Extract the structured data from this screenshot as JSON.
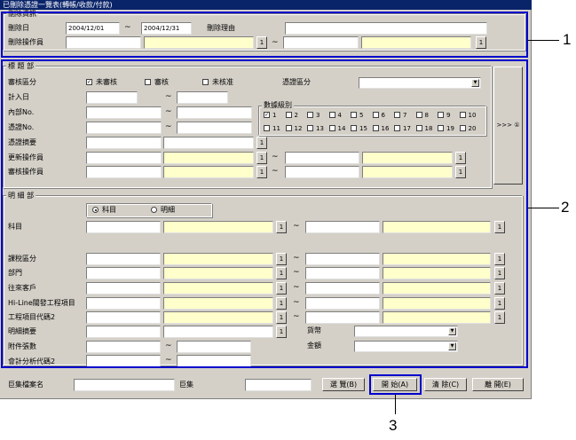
{
  "window": {
    "title": "已刪除憑證一覽表(轉帳/收款/付款)"
  },
  "delete_section": {
    "group_label": "刪除資訊",
    "delete_date_label": "刪除日",
    "date_from": "2004/12/01",
    "date_to": "2004/12/31",
    "reason_label": "刪除理由",
    "operator_label": "刪除操作員"
  },
  "header_section": {
    "group_label": "標 題 部",
    "review_status_label": "審核區分",
    "opt_unreviewed": "未審核",
    "opt_reviewed": "審核",
    "opt_unapproved": "未核准",
    "voucher_type_label": "憑證區分",
    "entry_date_label": "計入日",
    "internal_no_label": "內部No.",
    "voucher_no_label": "憑證No.",
    "voucher_summary_label": "憑證摘要",
    "update_operator_label": "更新操作員",
    "review_operator_label": "審核操作員",
    "digit_group_label": "數據級別",
    "digits": [
      "1",
      "2",
      "3",
      "4",
      "5",
      "6",
      "7",
      "8",
      "9",
      "10",
      "11",
      "12",
      "13",
      "14",
      "15",
      "16",
      "17",
      "18",
      "19",
      "20"
    ],
    "side_button": ">>> ①"
  },
  "detail_section": {
    "group_label": "明 細 部",
    "radio_subject": "科目",
    "radio_detail": "明細",
    "subject_label": "科目",
    "rows": [
      "課稅區分",
      "部門",
      "往來客戶",
      "Hi-Line關發工程項目",
      "工程項目代碼2"
    ],
    "summary_label": "明細摘要",
    "attach_label": "附件張數",
    "analysis_label": "會計分析代碼2",
    "currency_label": "貨幣",
    "amount_label": "金額"
  },
  "bottom": {
    "file_label": "巨集檔案名",
    "macro_label": "巨集",
    "browse": "選 覽(B)",
    "open": "開 始(A)",
    "clear": "清 除(C)",
    "close": "離 開(E)"
  },
  "tiny_btn": "1",
  "callouts": [
    "1",
    "2",
    "3"
  ]
}
